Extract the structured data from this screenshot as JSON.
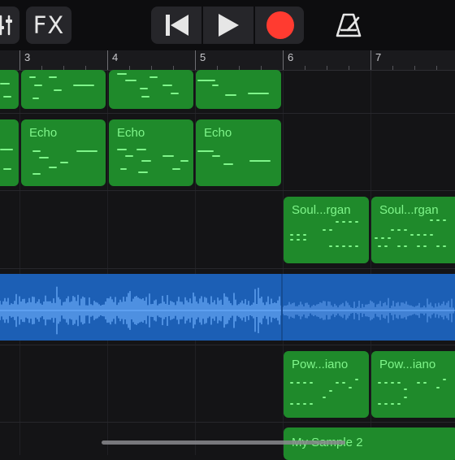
{
  "toolbar": {
    "fx_label": "FX",
    "icons": [
      "mixer-sliders-icon",
      "rewind-icon",
      "play-icon",
      "record-icon",
      "metronome-icon"
    ],
    "record_color": "#ff3b30"
  },
  "ruler": {
    "bars": [
      "3",
      "4",
      "5",
      "6",
      "7"
    ]
  },
  "regions": {
    "echo_label": "Echo",
    "soul_organ_label": "Soul...rgan",
    "power_piano_label": "Pow...iano",
    "sample_label": "My Sample 2"
  },
  "colors": {
    "midi_region": "#1f8a2b",
    "midi_note": "#7ff58a",
    "audio_region": "#1c5fb5",
    "waveform": "#6fb0ff"
  }
}
